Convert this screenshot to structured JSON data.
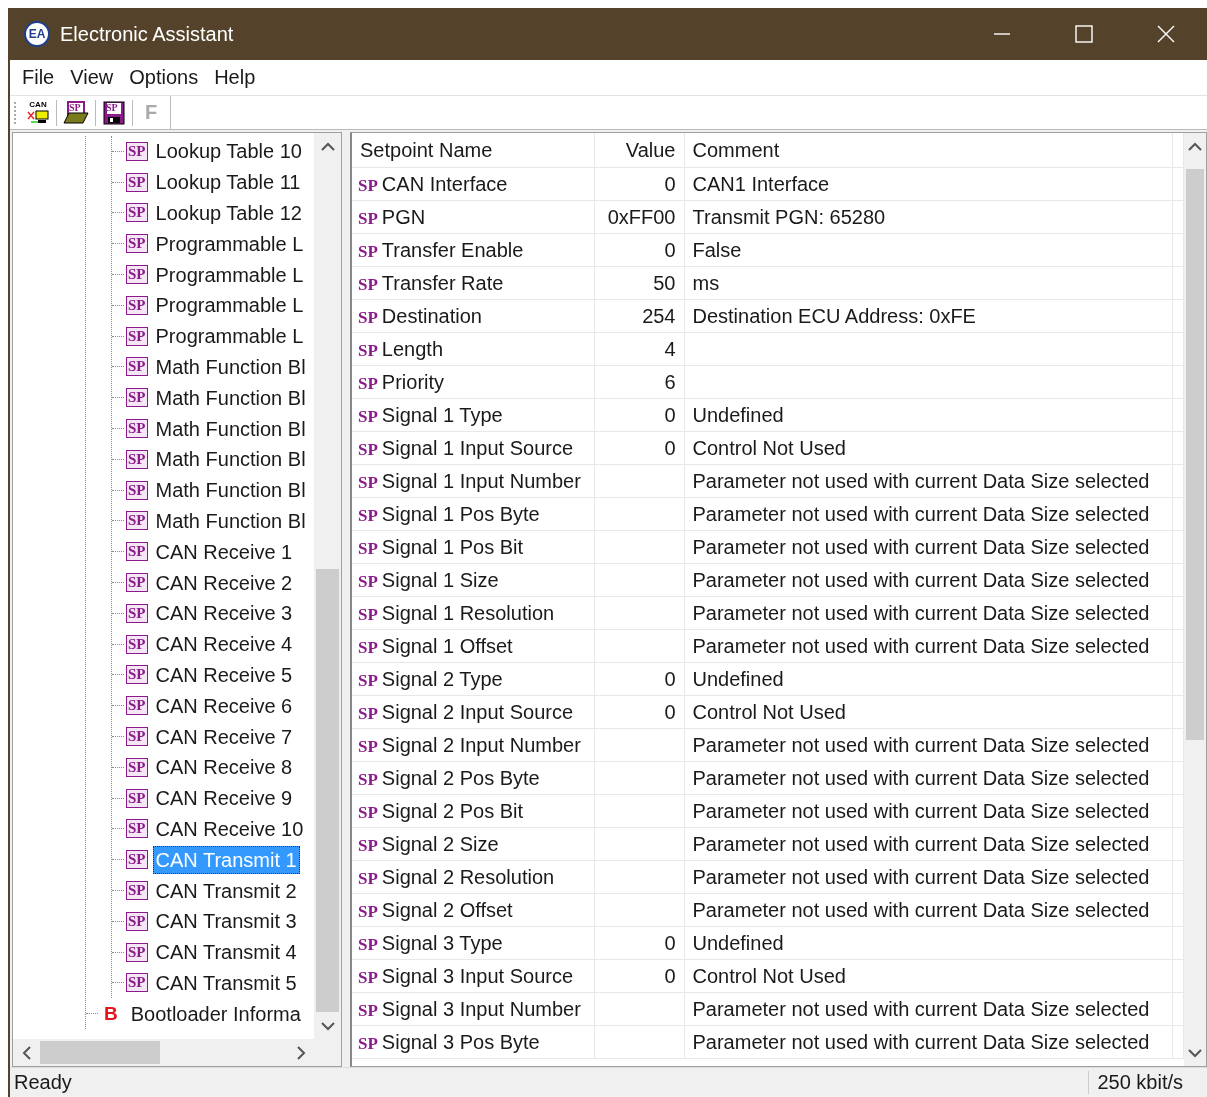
{
  "window": {
    "title": "Electronic Assistant",
    "logo": "EA"
  },
  "menu": [
    "File",
    "View",
    "Options",
    "Help"
  ],
  "toolbar": [
    {
      "kind": "can",
      "label": "CAN",
      "disabled": false
    },
    {
      "kind": "open",
      "label": "SP",
      "disabled": false
    },
    {
      "kind": "save",
      "label": "SP",
      "disabled": false
    },
    {
      "kind": "letter",
      "label": "F",
      "disabled": true
    }
  ],
  "tree": {
    "items": [
      {
        "kind": "group",
        "children": [
          {
            "badge": "SP",
            "label": "Lookup Table 10",
            "selected": false
          },
          {
            "badge": "SP",
            "label": "Lookup Table 11",
            "selected": false
          },
          {
            "badge": "SP",
            "label": "Lookup Table 12",
            "selected": false
          },
          {
            "badge": "SP",
            "label": "Programmable L",
            "selected": false
          },
          {
            "badge": "SP",
            "label": "Programmable L",
            "selected": false
          },
          {
            "badge": "SP",
            "label": "Programmable L",
            "selected": false
          },
          {
            "badge": "SP",
            "label": "Programmable L",
            "selected": false
          },
          {
            "badge": "SP",
            "label": "Math Function Bl",
            "selected": false
          },
          {
            "badge": "SP",
            "label": "Math Function Bl",
            "selected": false
          },
          {
            "badge": "SP",
            "label": "Math Function Bl",
            "selected": false
          },
          {
            "badge": "SP",
            "label": "Math Function Bl",
            "selected": false
          },
          {
            "badge": "SP",
            "label": "Math Function Bl",
            "selected": false
          },
          {
            "badge": "SP",
            "label": "Math Function Bl",
            "selected": false
          },
          {
            "badge": "SP",
            "label": "CAN Receive 1",
            "selected": false
          },
          {
            "badge": "SP",
            "label": "CAN Receive 2",
            "selected": false
          },
          {
            "badge": "SP",
            "label": "CAN Receive 3",
            "selected": false
          },
          {
            "badge": "SP",
            "label": "CAN Receive 4",
            "selected": false
          },
          {
            "badge": "SP",
            "label": "CAN Receive 5",
            "selected": false
          },
          {
            "badge": "SP",
            "label": "CAN Receive 6",
            "selected": false
          },
          {
            "badge": "SP",
            "label": "CAN Receive 7",
            "selected": false
          },
          {
            "badge": "SP",
            "label": "CAN Receive 8",
            "selected": false
          },
          {
            "badge": "SP",
            "label": "CAN Receive 9",
            "selected": false
          },
          {
            "badge": "SP",
            "label": "CAN Receive 10",
            "selected": false
          },
          {
            "badge": "SP",
            "label": "CAN Transmit 1",
            "selected": true
          },
          {
            "badge": "SP",
            "label": "CAN Transmit 2",
            "selected": false
          },
          {
            "badge": "SP",
            "label": "CAN Transmit 3",
            "selected": false
          },
          {
            "badge": "SP",
            "label": "CAN Transmit 4",
            "selected": false
          },
          {
            "badge": "SP",
            "label": "CAN Transmit 5",
            "selected": false
          }
        ]
      },
      {
        "kind": "leaf",
        "badge": "B",
        "label": "Bootloader Informa",
        "selected": false
      }
    ]
  },
  "table": {
    "columns": [
      "Setpoint Name",
      "Value",
      "Comment"
    ],
    "rows": [
      {
        "badge": "SP",
        "name": "CAN Interface",
        "value": "0",
        "comment": "CAN1 Interface"
      },
      {
        "badge": "SP",
        "name": "PGN",
        "value": "0xFF00",
        "comment": "Transmit PGN: 65280"
      },
      {
        "badge": "SP",
        "name": "Transfer Enable",
        "value": "0",
        "comment": "False"
      },
      {
        "badge": "SP",
        "name": "Transfer Rate",
        "value": "50",
        "comment": "ms"
      },
      {
        "badge": "SP",
        "name": "Destination",
        "value": "254",
        "comment": "Destination ECU Address: 0xFE"
      },
      {
        "badge": "SP",
        "name": "Length",
        "value": "4"
      },
      {
        "badge": "SP",
        "name": "Priority",
        "value": "6"
      },
      {
        "badge": "SP",
        "name": "Signal 1 Type",
        "value": "0",
        "comment": "Undefined"
      },
      {
        "badge": "SP",
        "name": "Signal 1 Input Source",
        "value": "0",
        "comment": "Control Not Used"
      },
      {
        "badge": "SP",
        "name": "Signal 1 Input Number",
        "comment": "Parameter not used with current Data Size selected"
      },
      {
        "badge": "SP",
        "name": "Signal 1 Pos Byte",
        "comment": "Parameter not used with current Data Size selected"
      },
      {
        "badge": "SP",
        "name": "Signal 1 Pos Bit",
        "comment": "Parameter not used with current Data Size selected"
      },
      {
        "badge": "SP",
        "name": "Signal 1 Size",
        "comment": "Parameter not used with current Data Size selected"
      },
      {
        "badge": "SP",
        "name": "Signal 1 Resolution",
        "comment": "Parameter not used with current Data Size selected"
      },
      {
        "badge": "SP",
        "name": "Signal 1 Offset",
        "comment": "Parameter not used with current Data Size selected"
      },
      {
        "badge": "SP",
        "name": "Signal 2 Type",
        "value": "0",
        "comment": "Undefined"
      },
      {
        "badge": "SP",
        "name": "Signal 2 Input Source",
        "value": "0",
        "comment": "Control Not Used"
      },
      {
        "badge": "SP",
        "name": "Signal 2 Input Number",
        "comment": "Parameter not used with current Data Size selected"
      },
      {
        "badge": "SP",
        "name": "Signal 2 Pos Byte",
        "comment": "Parameter not used with current Data Size selected"
      },
      {
        "badge": "SP",
        "name": "Signal 2 Pos Bit",
        "comment": "Parameter not used with current Data Size selected"
      },
      {
        "badge": "SP",
        "name": "Signal 2 Size",
        "comment": "Parameter not used with current Data Size selected"
      },
      {
        "badge": "SP",
        "name": "Signal 2 Resolution",
        "comment": "Parameter not used with current Data Size selected"
      },
      {
        "badge": "SP",
        "name": "Signal 2 Offset",
        "comment": "Parameter not used with current Data Size selected"
      },
      {
        "badge": "SP",
        "name": "Signal 3 Type",
        "value": "0",
        "comment": "Undefined"
      },
      {
        "badge": "SP",
        "name": "Signal 3 Input Source",
        "value": "0",
        "comment": "Control Not Used"
      },
      {
        "badge": "SP",
        "name": "Signal 3 Input Number",
        "comment": "Parameter not used with current Data Size selected"
      },
      {
        "badge": "SP",
        "name": "Signal 3 Pos Byte",
        "comment": "Parameter not used with current Data Size selected"
      }
    ]
  },
  "status_bar": {
    "text": "Ready",
    "baud": "250 kbit/s"
  }
}
